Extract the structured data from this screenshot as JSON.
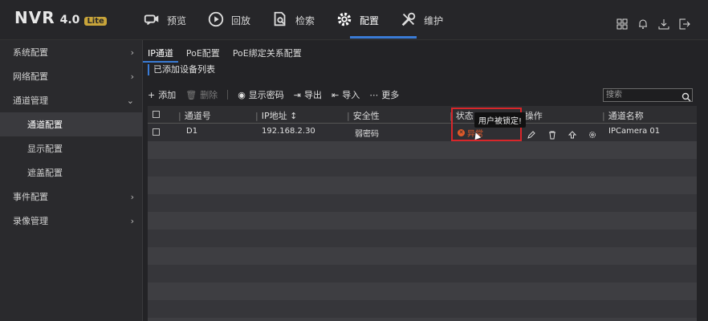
{
  "header": {
    "logo_text": "NVR",
    "version": "4.0",
    "edition": "Lite",
    "nav": [
      {
        "label": "预览",
        "icon": "camera-icon"
      },
      {
        "label": "回放",
        "icon": "play-icon"
      },
      {
        "label": "检索",
        "icon": "search-file-icon"
      },
      {
        "label": "配置",
        "icon": "gear-icon",
        "active": true
      },
      {
        "label": "维护",
        "icon": "wrench-icon"
      }
    ],
    "right_icons": [
      "layout-icon",
      "bell-icon",
      "download-icon",
      "logout-icon"
    ],
    "accent_color": "#3a7bd5"
  },
  "sidebar": {
    "items": [
      {
        "label": "系统配置",
        "chevron": "›"
      },
      {
        "label": "网络配置",
        "chevron": "›"
      },
      {
        "label": "通道管理",
        "chevron": "⌄"
      },
      {
        "label": "通道配置"
      },
      {
        "label": "显示配置"
      },
      {
        "label": "遮盖配置"
      },
      {
        "label": "事件配置",
        "chevron": "›"
      },
      {
        "label": "录像管理",
        "chevron": "›"
      }
    ]
  },
  "main": {
    "tabs": [
      "IP通道",
      "PoE配置",
      "PoE绑定关系配置"
    ],
    "subtitle": "已添加设备列表",
    "toolbar": {
      "add": "添加",
      "delete": "删除",
      "show_password": "显示密码",
      "export": "导出",
      "import": "导入",
      "more": "更多"
    },
    "search_placeholder": "搜索",
    "table": {
      "columns": [
        "通道号",
        "IP地址",
        "安全性",
        "状态",
        "操作",
        "通道名称"
      ],
      "sort_glyph": "↕",
      "rows": [
        {
          "channel": "D1",
          "ip": "192.168.2.30",
          "security": "弱密码",
          "status": "异常",
          "name": "IPCamera 01"
        }
      ]
    },
    "tooltip": "用户被锁定!",
    "status_error_color": "#e05a2a",
    "highlight_color": "#d8262a"
  }
}
